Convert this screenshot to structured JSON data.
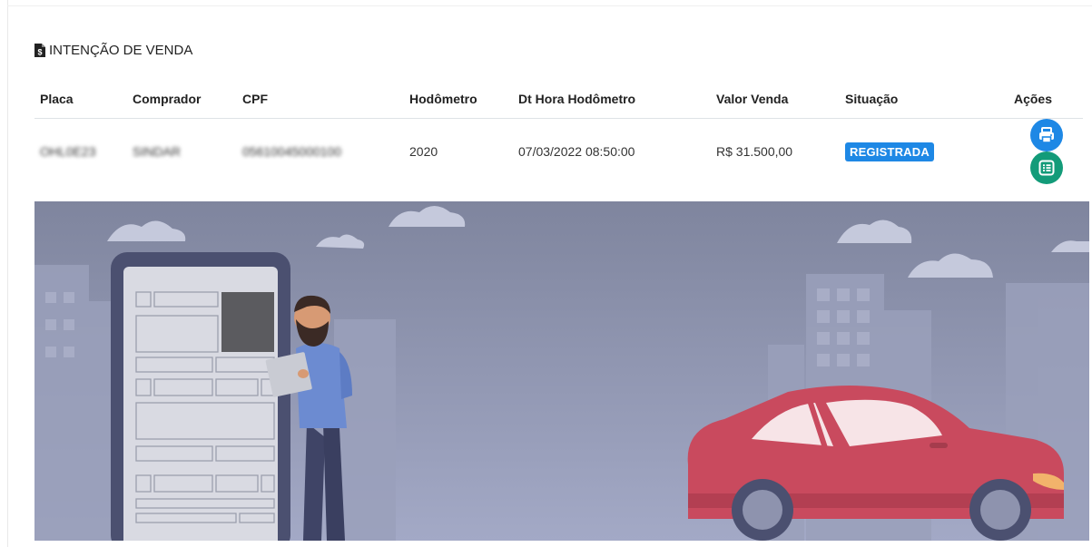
{
  "section": {
    "title": "INTENÇÃO DE VENDA",
    "icon": "document-dollar-icon"
  },
  "table": {
    "columns": [
      "Placa",
      "Comprador",
      "CPF",
      "Hodômetro",
      "Dt Hora Hodômetro",
      "Valor Venda",
      "Situação",
      "Ações"
    ],
    "rows": [
      {
        "placa": "OHL0E23",
        "comprador": "SINDAR",
        "cpf": "05610045000100",
        "hodometro": "2020",
        "dt_hora": "07/03/2022 08:50:00",
        "valor": "R$ 31.500,00",
        "situacao": "REGISTRADA",
        "actions": [
          "printer-icon",
          "list-icon"
        ]
      }
    ]
  },
  "colors": {
    "primary": "#1e88e5",
    "success": "#139b79",
    "car": "#c94a5e"
  }
}
